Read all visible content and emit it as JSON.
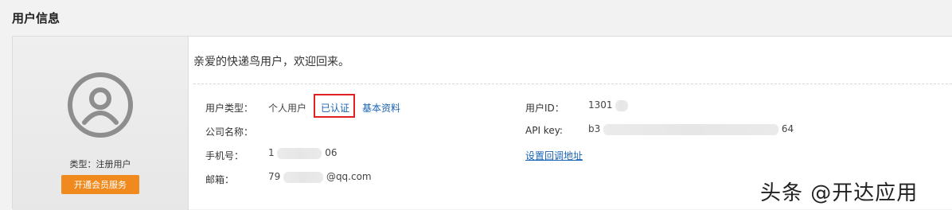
{
  "section_title": "用户信息",
  "left": {
    "type_text": "类型：注册用户",
    "member_button": "开通会员服务"
  },
  "welcome": "亲爱的快递鸟用户，欢迎回来。",
  "fields": {
    "user_type_label": "用户类型：",
    "user_type_value": "个人用户",
    "verified": "已认证",
    "basic_info": "基本资料",
    "company_label": "公司名称：",
    "phone_label": "手机号：",
    "phone_prefix": "1",
    "phone_suffix": "06",
    "email_label": "邮箱：",
    "email_prefix": "79",
    "email_suffix": "@qq.com",
    "userid_label": "用户ID：",
    "userid_value": "1301",
    "apikey_label": "API key:",
    "apikey_prefix": "b3",
    "apikey_suffix": "64",
    "callback_link": "设置回调地址"
  },
  "watermark": "头条 @开达应用",
  "colors": {
    "accent_orange": "#f08a1e",
    "link_blue": "#1a63b5",
    "highlight_red": "#e02020"
  }
}
